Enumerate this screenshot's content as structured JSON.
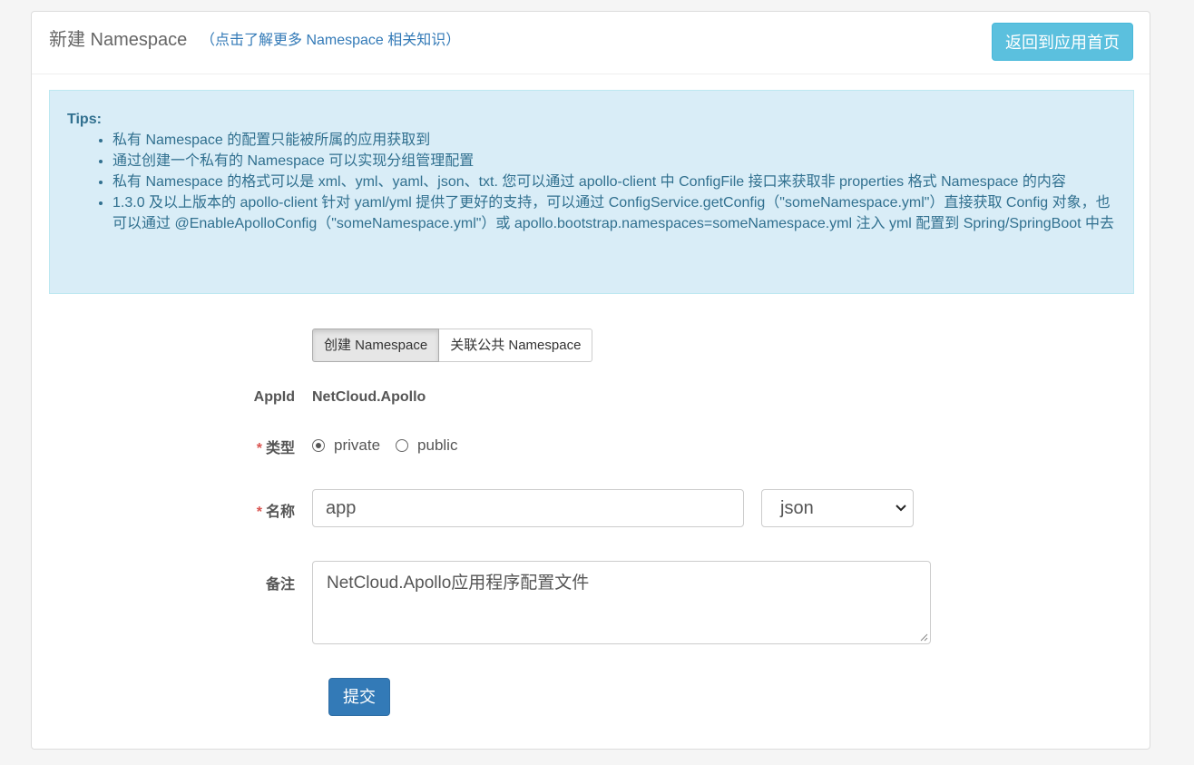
{
  "header": {
    "title": "新建 Namespace",
    "help_link": "（点击了解更多 Namespace 相关知识）",
    "back_button": "返回到应用首页"
  },
  "tips": {
    "title": "Tips:",
    "items": [
      "私有 Namespace 的配置只能被所属的应用获取到",
      "通过创建一个私有的 Namespace 可以实现分组管理配置",
      "私有 Namespace 的格式可以是 xml、yml、yaml、json、txt. 您可以通过 apollo-client 中 ConfigFile 接口来获取非 properties 格式 Namespace 的内容",
      "1.3.0 及以上版本的 apollo-client 针对 yaml/yml 提供了更好的支持，可以通过 ConfigService.getConfig（\"someNamespace.yml\"）直接获取 Config 对象，也可以通过 @EnableApolloConfig（\"someNamespace.yml\"）或 apollo.bootstrap.namespaces=someNamespace.yml 注入 yml 配置到 Spring/SpringBoot 中去"
    ]
  },
  "mode_tabs": {
    "create": "创建 Namespace",
    "associate": "关联公共 Namespace"
  },
  "form": {
    "appid_label": "AppId",
    "appid_value": "NetCloud.Apollo",
    "required_mark": "*",
    "type_label": "类型",
    "type_options": [
      "private",
      "public"
    ],
    "type_selected": "private",
    "name_label": "名称",
    "name_value": "app",
    "format_selected": "json",
    "comment_label": "备注",
    "comment_value": "NetCloud.Apollo应用程序配置文件",
    "submit": "提交"
  },
  "colors": {
    "primary": "#337ab7",
    "info": "#5bc0de",
    "tips_bg": "#d9edf7",
    "tips_text": "#31708f",
    "required": "#d9534f"
  }
}
